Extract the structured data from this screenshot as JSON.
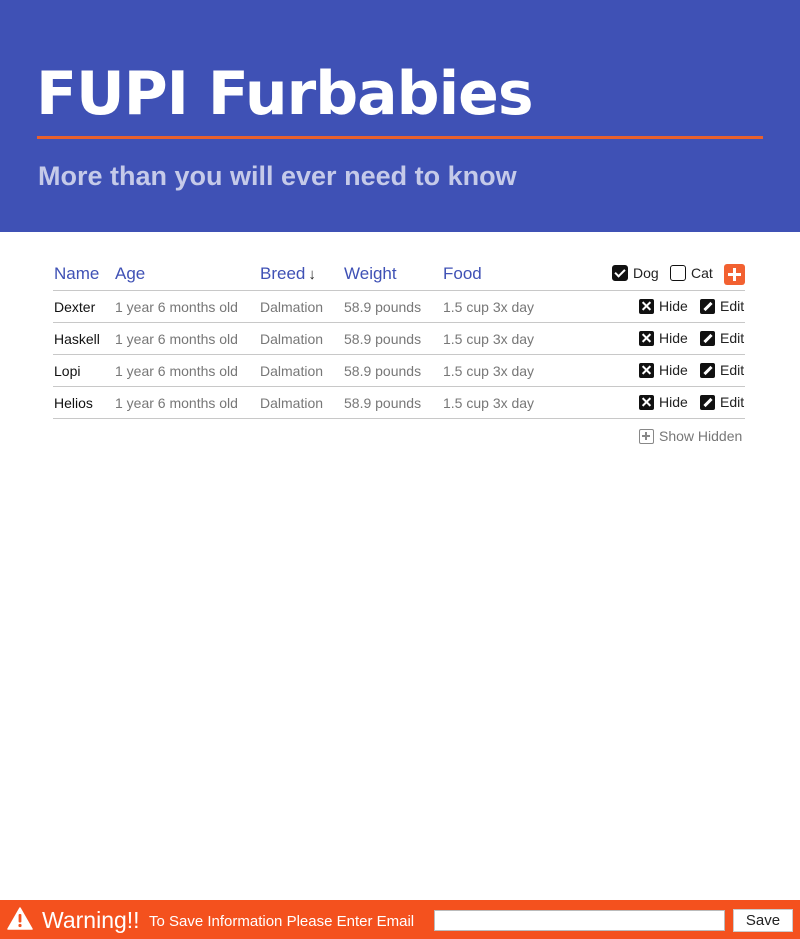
{
  "header": {
    "title": "FUPI Furbabies",
    "subtitle": "More than you will ever need to know"
  },
  "table": {
    "columns": {
      "name": "Name",
      "age": "Age",
      "breed": "Breed",
      "weight": "Weight",
      "food": "Food"
    },
    "sort_indicator": "↓",
    "filters": {
      "dog_label": "Dog",
      "dog_checked": true,
      "cat_label": "Cat",
      "cat_checked": false
    },
    "rows": [
      {
        "name": "Dexter",
        "age": "1 year 6 months old",
        "breed": "Dalmation",
        "weight": "58.9 pounds",
        "food": "1.5 cup 3x day"
      },
      {
        "name": "Haskell",
        "age": "1 year 6 months old",
        "breed": "Dalmation",
        "weight": "58.9 pounds",
        "food": "1.5 cup 3x day"
      },
      {
        "name": "Lopi",
        "age": "1 year 6 months old",
        "breed": "Dalmation",
        "weight": "58.9 pounds",
        "food": "1.5 cup 3x day"
      },
      {
        "name": "Helios",
        "age": "1 year 6 months old",
        "breed": "Dalmation",
        "weight": "58.9 pounds",
        "food": "1.5 cup 3x day"
      }
    ],
    "actions": {
      "hide_label": "Hide",
      "edit_label": "Edit"
    },
    "show_hidden_label": "Show Hidden"
  },
  "warning": {
    "title": "Warning!!",
    "message": "To Save Information Please Enter Email",
    "email_value": "",
    "save_label": "Save"
  },
  "colors": {
    "header_bg": "#3f51b5",
    "accent": "#f26131",
    "warning_bg": "#f4511e"
  },
  "icons": {
    "hide": "close-square-icon",
    "edit": "pencil-square-icon",
    "add": "plus-square-icon",
    "show_hidden": "plus-square-outline-icon",
    "warning": "warning-triangle-icon",
    "sort": "arrow-down-icon"
  }
}
